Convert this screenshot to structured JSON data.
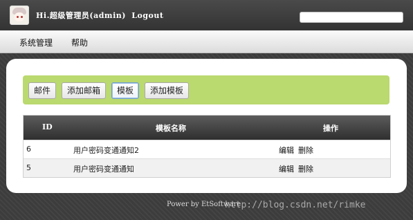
{
  "header": {
    "greeting": "Hi.超级管理员(admin)",
    "logout_label": "Logout",
    "search_value": ""
  },
  "menu": {
    "items": [
      {
        "label": "系统管理"
      },
      {
        "label": "帮助"
      }
    ]
  },
  "toolbar": {
    "buttons": [
      {
        "label": "邮件"
      },
      {
        "label": "添加邮箱"
      },
      {
        "label": "模板",
        "active": true
      },
      {
        "label": "添加模板"
      }
    ]
  },
  "table": {
    "columns": [
      "ID",
      "模板名称",
      "操作"
    ],
    "rows": [
      {
        "id": "6",
        "name": "用户密码变通通知2",
        "actions": [
          "编辑",
          "删除"
        ]
      },
      {
        "id": "5",
        "name": "用户密码变通通知",
        "actions": [
          "编辑",
          "删除"
        ]
      }
    ]
  },
  "footer": {
    "text": "Power by EtSoftware"
  },
  "watermark": "http://blog.csdn.net/rimke",
  "colors": {
    "toolbar_bg": "#bad96f",
    "header_bg": "#3a3a3a",
    "active_button_border": "#6f9ccf"
  }
}
